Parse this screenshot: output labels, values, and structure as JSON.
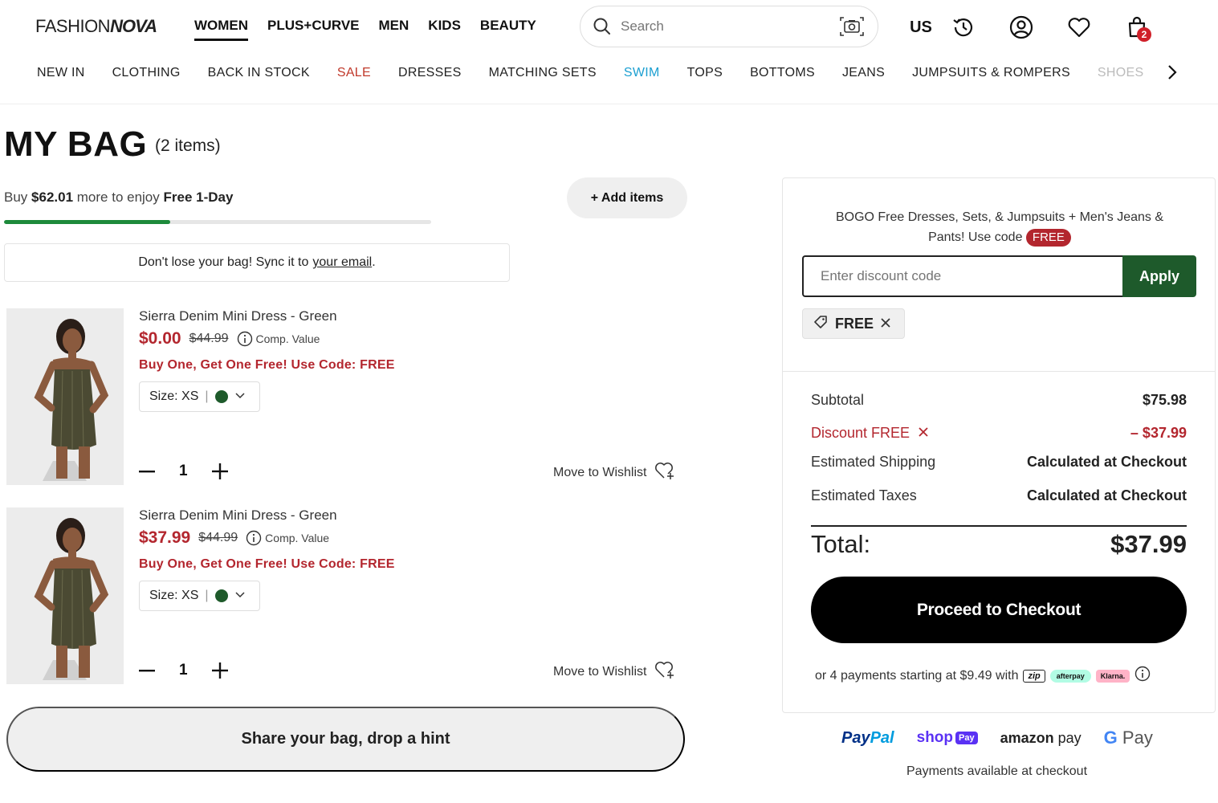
{
  "header": {
    "logo_part1": "FASHION",
    "logo_part2": "NOVA",
    "top_nav": [
      "WOMEN",
      "PLUS+CURVE",
      "MEN",
      "KIDS",
      "BEAUTY"
    ],
    "search_placeholder": "Search",
    "region": "US",
    "cart_count": "2",
    "icons": [
      "search-icon",
      "camera-icon",
      "history-icon",
      "account-icon",
      "heart-icon",
      "bag-icon"
    ]
  },
  "categories": [
    "NEW IN",
    "CLOTHING",
    "BACK IN STOCK",
    "SALE",
    "DRESSES",
    "MATCHING SETS",
    "SWIM",
    "TOPS",
    "BOTTOMS",
    "JEANS",
    "JUMPSUITS & ROMPERS",
    "SHOES"
  ],
  "bag": {
    "title": "MY BAG",
    "count": "(2 items)",
    "ship_prefix": "Buy",
    "ship_amount": "$62.01",
    "ship_middle": "more to enjoy",
    "ship_bold": "Free 1-Day",
    "ship_progress": 0.39,
    "add_items": "+ Add items",
    "sync_text": "Don't lose your bag! Sync it to",
    "sync_link": "your email",
    "sync_end": "."
  },
  "items": [
    {
      "name": "Sierra Denim Mini Dress - Green",
      "price": "$0.00",
      "orig_price": "$44.99",
      "comp": "Comp. Value",
      "promo": "Buy One, Get One Free! Use Code: FREE",
      "size": "Size: XS",
      "color_hex": "#1e5a2b",
      "qty": "1",
      "wishlist": "Move to Wishlist"
    },
    {
      "name": "Sierra Denim Mini Dress - Green",
      "price": "$37.99",
      "orig_price": "$44.99",
      "comp": "Comp. Value",
      "promo": "Buy One, Get One Free! Use Code: FREE",
      "size": "Size: XS",
      "color_hex": "#1e5a2b",
      "qty": "1",
      "wishlist": "Move to Wishlist"
    }
  ],
  "share": "Share your bag, drop a hint",
  "summary": {
    "promo_line1": "BOGO Free Dresses, Sets, & Jumpsuits + Men's Jeans &",
    "promo_line2": "Pants! Use code",
    "promo_code": "FREE",
    "discount_placeholder": "Enter discount code",
    "apply": "Apply",
    "applied_code": "FREE",
    "subtotal_label": "Subtotal",
    "subtotal": "$75.98",
    "discount_label": "Discount FREE",
    "discount": "– $37.99",
    "shipping_label": "Estimated Shipping",
    "shipping": "Calculated at Checkout",
    "taxes_label": "Estimated Taxes",
    "taxes": "Calculated at Checkout",
    "total_label": "Total:",
    "total": "$37.99",
    "checkout": "Proceed to Checkout",
    "bnpl_text": "or 4 payments starting at $9.49 with",
    "bnpl_zip": "zip",
    "bnpl_afterpay": "afterpay",
    "bnpl_klarna": "Klarna."
  },
  "payments": {
    "paypal_a": "Pay",
    "paypal_b": "Pal",
    "shop": "shop",
    "shop_pay": "Pay",
    "amazon_a": "amazon",
    "amazon_b": "pay",
    "gpay_g": "G",
    "gpay": "Pay",
    "note": "Payments available at checkout"
  },
  "colors": {
    "accent_red": "#b3262e",
    "green": "#1e5a2b",
    "progress_green": "#1d8a3b",
    "swim_blue": "#1b9fd1"
  }
}
